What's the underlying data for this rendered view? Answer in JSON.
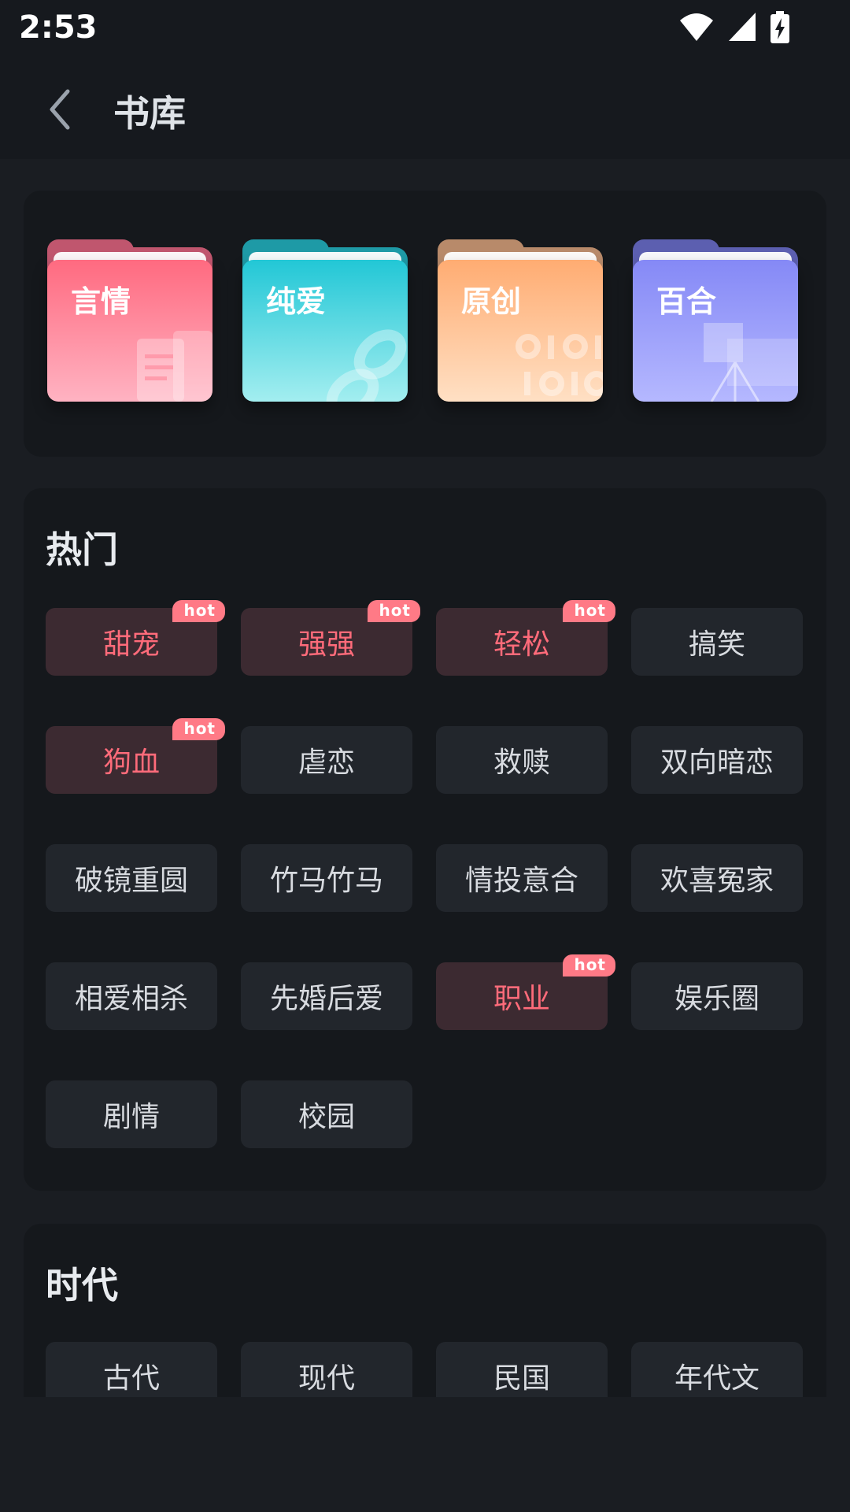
{
  "status_bar": {
    "time": "2:53"
  },
  "app_bar": {
    "title": "书库"
  },
  "categories": [
    {
      "label": "言情",
      "color_top": "#ff6a80",
      "color_bottom": "#ffb3c2"
    },
    {
      "label": "纯爱",
      "color_top": "#22c7d6",
      "color_bottom": "#a3eef0"
    },
    {
      "label": "原创",
      "color_top": "#ffac72",
      "color_bottom": "#ffe0c4"
    },
    {
      "label": "百合",
      "color_top": "#8589f6",
      "color_bottom": "#b5b8ff"
    }
  ],
  "hot_section": {
    "title": "热门",
    "hot_badge": "hot",
    "tags": [
      {
        "label": "甜宠",
        "hot": true
      },
      {
        "label": "强强",
        "hot": true
      },
      {
        "label": "轻松",
        "hot": true
      },
      {
        "label": "搞笑",
        "hot": false
      },
      {
        "label": "狗血",
        "hot": true
      },
      {
        "label": "虐恋",
        "hot": false
      },
      {
        "label": "救赎",
        "hot": false
      },
      {
        "label": "双向暗恋",
        "hot": false
      },
      {
        "label": "破镜重圆",
        "hot": false
      },
      {
        "label": "竹马竹马",
        "hot": false
      },
      {
        "label": "情投意合",
        "hot": false
      },
      {
        "label": "欢喜冤家",
        "hot": false
      },
      {
        "label": "相爱相杀",
        "hot": false
      },
      {
        "label": "先婚后爱",
        "hot": false
      },
      {
        "label": "职业",
        "hot": true
      },
      {
        "label": "娱乐圈",
        "hot": false
      },
      {
        "label": "剧情",
        "hot": false
      },
      {
        "label": "校园",
        "hot": false
      }
    ]
  },
  "era_section": {
    "title": "时代",
    "tags": [
      {
        "label": "古代"
      },
      {
        "label": "现代"
      },
      {
        "label": "民国"
      },
      {
        "label": "年代文"
      }
    ]
  },
  "colors": {
    "hot_text": "#ff6b7a",
    "hot_badge": "#ff7a86",
    "background": "#1a1d22"
  }
}
